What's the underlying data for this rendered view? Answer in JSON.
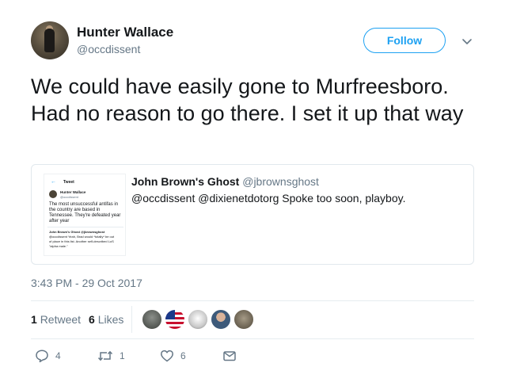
{
  "author": {
    "name": "Hunter Wallace",
    "handle": "@occdissent"
  },
  "follow_label": "Follow",
  "tweet_text": "We could have easily gone to Murfreesboro. Had no reason to go there. I set it up that way",
  "quote": {
    "name": "John Brown's Ghost",
    "handle": "@jbrownsghost",
    "text": "@occdissent @dixienetdotorg Spoke too soon, playboy.",
    "thumb": {
      "header": "Tweet",
      "name": "Hunter Wallace",
      "handle": "@occdissent",
      "text1": "The most unsuccessful antifas in",
      "text2": "the country are based in",
      "text3": "Tennessee. They're defeated year",
      "text4": "after year",
      "reply_name": "John Brown's Ghost @jbrownsghost",
      "reply1": "@occdissent Yeah, Brad would *totally* be out",
      "reply2": "of place in this list. Another self-described LoS",
      "reply3": "\"alpha male.\""
    }
  },
  "timestamp": "3:43 PM - 29 Oct 2017",
  "stats": {
    "retweets": "1",
    "retweets_label": "Retweet",
    "likes": "6",
    "likes_label": "Likes"
  },
  "actions": {
    "replies": "4",
    "retweets": "1",
    "likes": "6"
  },
  "colors": {
    "accent": "#1da1f2",
    "muted": "#657786",
    "text": "#14171a"
  }
}
